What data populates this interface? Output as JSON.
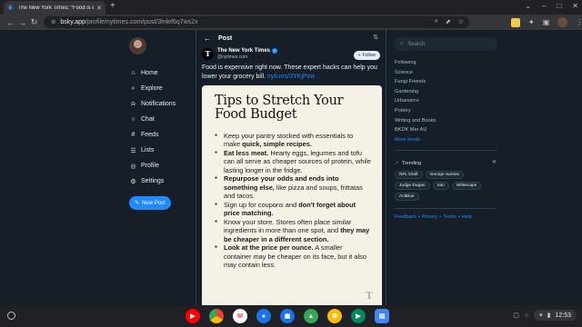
{
  "browser": {
    "tab_title": "The New York Times: “Food is e",
    "new_tab": "+",
    "url_host": "bsky.app",
    "url_path": "/profile/nytimes.com/post/3lnlef6q7ws2x"
  },
  "nav": {
    "items": [
      {
        "label": "Home",
        "icon": "house-icon"
      },
      {
        "label": "Explore",
        "icon": "search-icon"
      },
      {
        "label": "Notifications",
        "icon": "bell-icon"
      },
      {
        "label": "Chat",
        "icon": "chat-icon"
      },
      {
        "label": "Feeds",
        "icon": "hash-icon"
      },
      {
        "label": "Lists",
        "icon": "list-icon"
      },
      {
        "label": "Profile",
        "icon": "person-icon"
      },
      {
        "label": "Settings",
        "icon": "gear-icon"
      }
    ],
    "new_post": "New Post"
  },
  "post_header": {
    "title": "Post"
  },
  "post": {
    "author_name": "The New York Times",
    "author_handle": "@nytimes.com",
    "follow_label": "Follow",
    "text": "Food is expensive right now. These expert hacks can help you lower your grocery bill.",
    "link": "nyti.ms/3YKjPzw"
  },
  "card": {
    "title": "Tips to Stretch Your Food Budget",
    "bullets": [
      {
        "pre": "Keep your pantry stocked with essentials to make ",
        "bold": "quick, simple recipes.",
        "post": ""
      },
      {
        "pre": "",
        "bold": "Eat less meat.",
        "post": " Hearty eggs, legumes and tofu can all serve as cheaper sources of protein, while lasting longer in the fridge."
      },
      {
        "pre": "",
        "bold": "Repurpose your odds and ends into something else,",
        "post": " like pizza and soups, frittatas and tacos."
      },
      {
        "pre": "Sign up for coupons and ",
        "bold": "don't forget about price matching.",
        "post": ""
      },
      {
        "pre": "Know your store. Stores often place similar ingredients in more than one spot, and ",
        "bold": "they may be cheaper in a different section.",
        "post": ""
      },
      {
        "pre": "",
        "bold": "Look at the price per ounce.",
        "post": " A smaller container may be cheaper on its face, but it also may contain less."
      }
    ]
  },
  "right": {
    "search_placeholder": "Search",
    "feeds": [
      "Following",
      "Science",
      "Fungi Friends",
      "Gardening",
      "Urbanism+",
      "Pottery",
      "Writing and Books",
      "BKDK Mer AU"
    ],
    "more_feeds": "More feeds",
    "trending_title": "Trending",
    "trending": [
      "NFL Draft",
      "George Santos",
      "Judge Dugan",
      "Iran",
      "Whitecaps",
      "ActBlue"
    ],
    "footer": [
      "Feedback",
      "Privacy",
      "Terms",
      "Help"
    ]
  },
  "shelf": {
    "time": "12:53"
  },
  "colors": {
    "accent": "#208bfe",
    "page_bg": "#161e27"
  }
}
